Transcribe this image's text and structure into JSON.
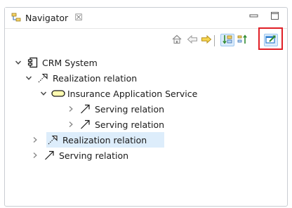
{
  "view": {
    "tab_title": "Navigator",
    "tab_close": "☒"
  },
  "toolbar": {
    "buttons": [
      {
        "icon": "home-icon"
      },
      {
        "icon": "back-arrow-icon"
      },
      {
        "icon": "forward-arrow-icon"
      },
      {
        "icon": "incoming-relations-icon",
        "pressed": true
      },
      {
        "icon": "outgoing-relations-icon"
      },
      {
        "icon": "pin-view-icon",
        "pressed": true,
        "highlighted": true
      }
    ]
  },
  "colors": {
    "selection": "#ddedfb",
    "highlight_frame": "#e01f26",
    "service_fill": "#fffcb0",
    "arrow_yellow": "#e9c53a"
  },
  "tree": [
    {
      "label": "CRM System",
      "icon": "application-component-icon",
      "level": 0,
      "expanded": true
    },
    {
      "label": "Realization relation",
      "icon": "realization-relation-icon",
      "level": 1,
      "expanded": true
    },
    {
      "label": "Insurance Application Service",
      "icon": "application-service-icon",
      "level": 2,
      "expanded": true
    },
    {
      "label": "Serving relation",
      "icon": "serving-relation-icon",
      "level": 3,
      "expanded": false
    },
    {
      "label": "Serving relation",
      "icon": "serving-relation-icon",
      "level": 3,
      "expanded": false
    },
    {
      "label": "Realization relation",
      "icon": "realization-relation-icon",
      "level": 0,
      "expanded": false,
      "selected": true
    },
    {
      "label": "Serving relation",
      "icon": "serving-relation-icon",
      "level": 0,
      "expanded": false
    }
  ]
}
